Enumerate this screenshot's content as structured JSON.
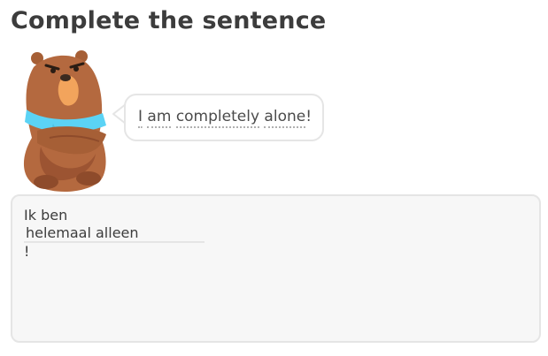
{
  "header": {
    "title": "Complete the sentence"
  },
  "character": {
    "icon": "bear-arms-crossed-icon",
    "accent_color": "#5bd3f5",
    "fur_color": "#b4693f"
  },
  "prompt": {
    "word_1": "I",
    "word_2": "am",
    "word_3": "completely",
    "word_4": "alone",
    "punctuation": "!"
  },
  "answer": {
    "prefix": "Ik ben",
    "input_value": "helemaal alleen",
    "suffix": "!"
  }
}
